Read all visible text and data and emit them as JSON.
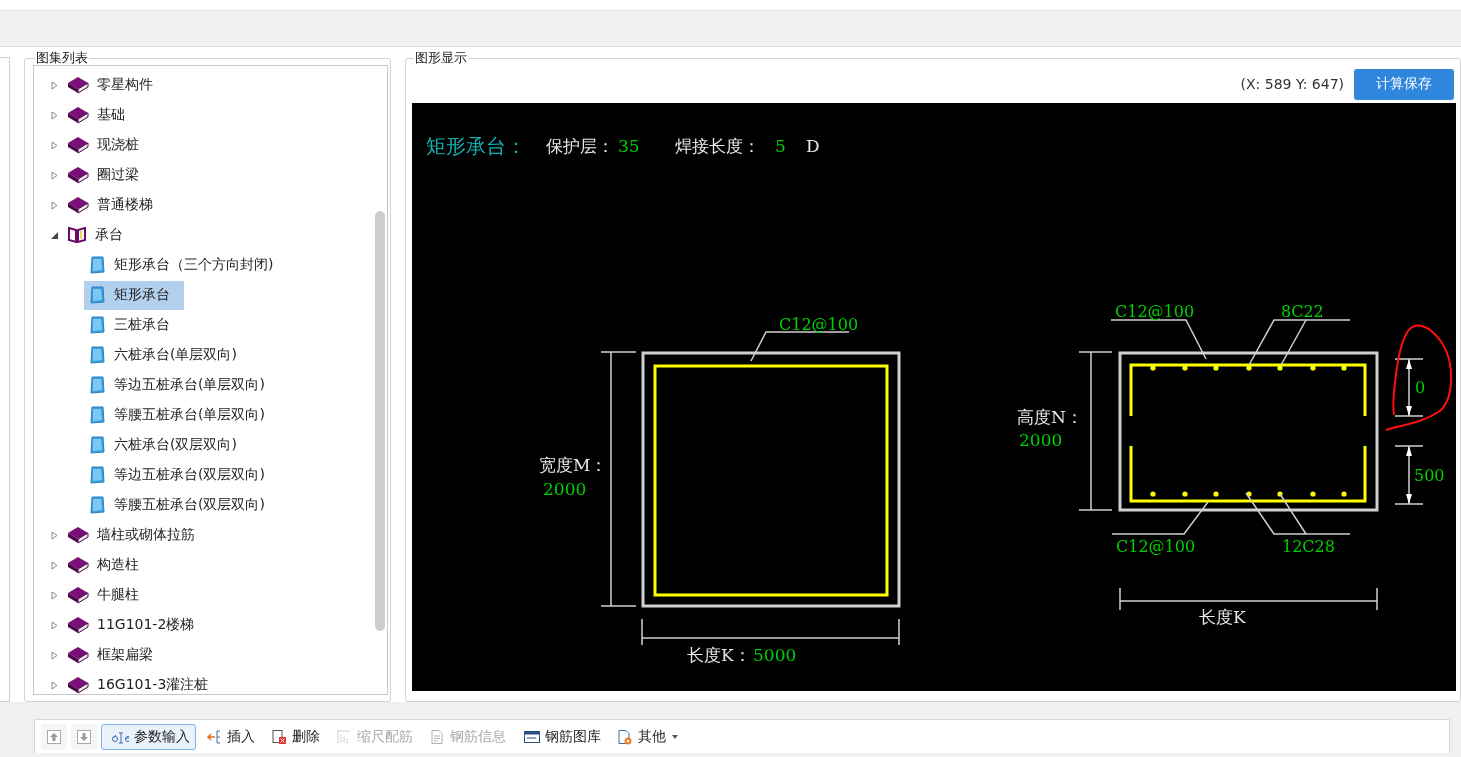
{
  "atlas_panel": {
    "title": "图集列表",
    "tree": [
      {
        "label": "零星构件",
        "expanded": false
      },
      {
        "label": "基础",
        "expanded": false
      },
      {
        "label": "现浇桩",
        "expanded": false
      },
      {
        "label": "圈过梁",
        "expanded": false
      },
      {
        "label": "普通楼梯",
        "expanded": false
      },
      {
        "label": "承台",
        "expanded": true,
        "children": [
          {
            "label": "矩形承台（三个方向封闭)",
            "selected": false
          },
          {
            "label": "矩形承台",
            "selected": true
          },
          {
            "label": "三桩承台",
            "selected": false
          },
          {
            "label": "六桩承台(单层双向)",
            "selected": false
          },
          {
            "label": "等边五桩承台(单层双向)",
            "selected": false
          },
          {
            "label": "等腰五桩承台(单层双向)",
            "selected": false
          },
          {
            "label": "六桩承台(双层双向)",
            "selected": false
          },
          {
            "label": "等边五桩承台(双层双向)",
            "selected": false
          },
          {
            "label": "等腰五桩承台(双层双向)",
            "selected": false
          }
        ]
      },
      {
        "label": "墙柱或砌体拉筋",
        "expanded": false
      },
      {
        "label": "构造柱",
        "expanded": false
      },
      {
        "label": "牛腿柱",
        "expanded": false
      },
      {
        "label": "11G101-2楼梯",
        "expanded": false
      },
      {
        "label": "框架扁梁",
        "expanded": false
      },
      {
        "label": "16G101-3灌注桩",
        "expanded": false
      }
    ]
  },
  "graphic_panel": {
    "title": "图形显示",
    "coordinates": "(X: 589 Y: 647)",
    "save_button": "计算保存",
    "drawing": {
      "title": "矩形承台：",
      "cover_label": "保护层：",
      "cover_value": "35",
      "weld_label": "焊接长度：",
      "weld_value": "5",
      "weld_unit": "D",
      "plan": {
        "stirrup": "C12@100",
        "width_label": "宽度M：",
        "width_value": "2000",
        "length_label": "长度K：",
        "length_value": "5000"
      },
      "section": {
        "top_stirrup": "C12@100",
        "top_bars": "8C22",
        "bottom_stirrup": "C12@100",
        "bottom_bars": "12C28",
        "height_label": "高度N：",
        "height_value": "2000",
        "top_dimension": "0",
        "bottom_dimension": "500",
        "length_label": "长度K"
      }
    }
  },
  "toolbar": [
    {
      "kind": "move-up",
      "disabled": true,
      "selected": false
    },
    {
      "kind": "move-down",
      "disabled": true,
      "selected": false
    },
    {
      "kind": "params",
      "label": "参数输入",
      "disabled": false,
      "selected": true
    },
    {
      "kind": "insert",
      "label": "插入",
      "disabled": false,
      "selected": false
    },
    {
      "kind": "delete",
      "label": "删除",
      "disabled": false,
      "selected": false
    },
    {
      "kind": "scale",
      "label": "缩尺配筋",
      "disabled": true,
      "selected": false
    },
    {
      "kind": "info",
      "label": "钢筋信息",
      "disabled": true,
      "selected": false
    },
    {
      "kind": "library",
      "label": "钢筋图库",
      "disabled": false,
      "selected": false
    },
    {
      "kind": "other",
      "label": "其他",
      "disabled": false,
      "selected": false
    }
  ]
}
